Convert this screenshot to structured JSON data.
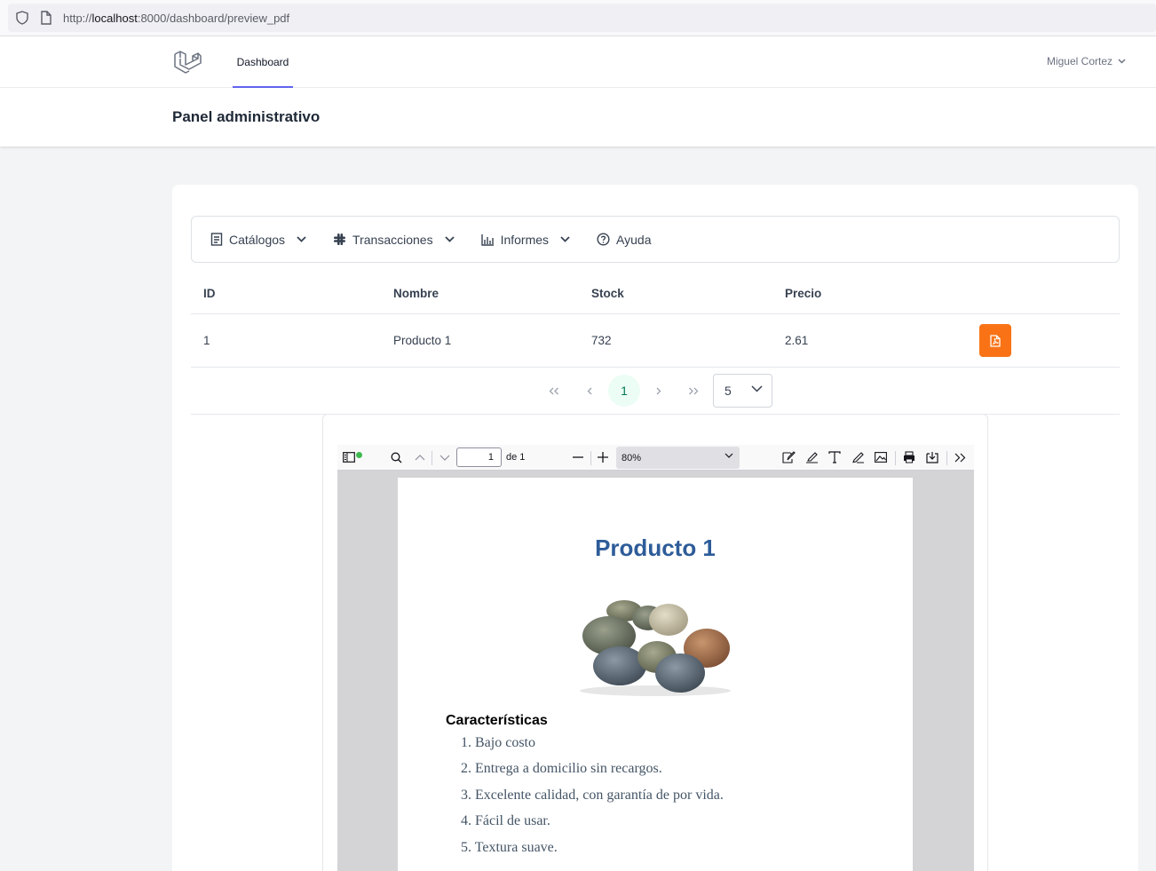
{
  "browser": {
    "url_scheme": "http://",
    "url_host": "localhost",
    "url_rest": ":8000/dashboard/preview_pdf"
  },
  "nav": {
    "link": "Dashboard",
    "user": "Miguel Cortez"
  },
  "header": {
    "title": "Panel administrativo"
  },
  "menu": [
    {
      "label": "Catálogos",
      "icon": "document-list-icon"
    },
    {
      "label": "Transacciones",
      "icon": "slack-hash-icon"
    },
    {
      "label": "Informes",
      "icon": "bar-chart-icon"
    },
    {
      "label": "Ayuda",
      "icon": "question-circle-icon"
    }
  ],
  "table": {
    "columns": [
      "ID",
      "Nombre",
      "Stock",
      "Precio"
    ],
    "rows": [
      {
        "id": "1",
        "nombre": "Producto 1",
        "stock": "732",
        "precio": "2.61"
      }
    ]
  },
  "pager": {
    "current": "1",
    "rows_per_page": "5"
  },
  "viewer": {
    "page": "1",
    "page_of": "de 1",
    "zoom": "80%"
  },
  "pdf": {
    "title": "Producto 1",
    "features_heading": "Características",
    "features": [
      "1. Bajo costo",
      "2. Entrega a domicilio sin recargos.",
      "3. Excelente calidad, con garantía de por vida.",
      "4. Fácil de usar.",
      "5. Textura suave."
    ]
  },
  "colors": {
    "accent": "#6366f1",
    "pdf_button": "#f97316",
    "pdf_title": "#2e5c99"
  }
}
